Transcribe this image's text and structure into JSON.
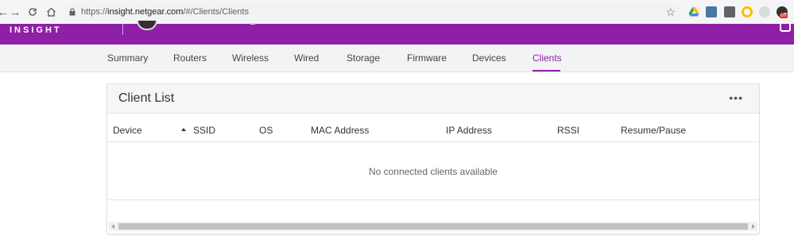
{
  "browser": {
    "back_glyph": "←",
    "forward_glyph": "→",
    "reload_glyph": "C",
    "home_glyph": "⌂",
    "url_scheme": "https://",
    "url_host": "insight.netgear.com",
    "url_path": "/#/Clients/Clients",
    "star_glyph": "☆",
    "extensions": [
      {
        "icon": "google-drive-icon",
        "color": "#34a853"
      },
      {
        "icon": "image-extension-icon",
        "color": "#4a76a8"
      },
      {
        "icon": "chart-extension-icon",
        "color": "#5f6368"
      },
      {
        "icon": "chrome-extension-icon",
        "color": "#fbbc04"
      },
      {
        "icon": "cloud-extension-icon",
        "color": "#9aa0a6"
      }
    ],
    "off_badge": "off"
  },
  "app": {
    "brand": "INSIGHT",
    "accent_color": "#8e1fa6"
  },
  "tabs": [
    {
      "label": "Summary",
      "active": false
    },
    {
      "label": "Routers",
      "active": false
    },
    {
      "label": "Wireless",
      "active": false
    },
    {
      "label": "Wired",
      "active": false
    },
    {
      "label": "Storage",
      "active": false
    },
    {
      "label": "Firmware",
      "active": false
    },
    {
      "label": "Devices",
      "active": false
    },
    {
      "label": "Clients",
      "active": true
    }
  ],
  "card": {
    "title": "Client List",
    "more_glyph": "•••",
    "columns": [
      "Device",
      "SSID",
      "OS",
      "MAC Address",
      "IP Address",
      "RSSI",
      "Resume/Pause"
    ],
    "sorted_column": "Device",
    "sort_direction": "ascending",
    "empty_message": "No connected clients available"
  }
}
